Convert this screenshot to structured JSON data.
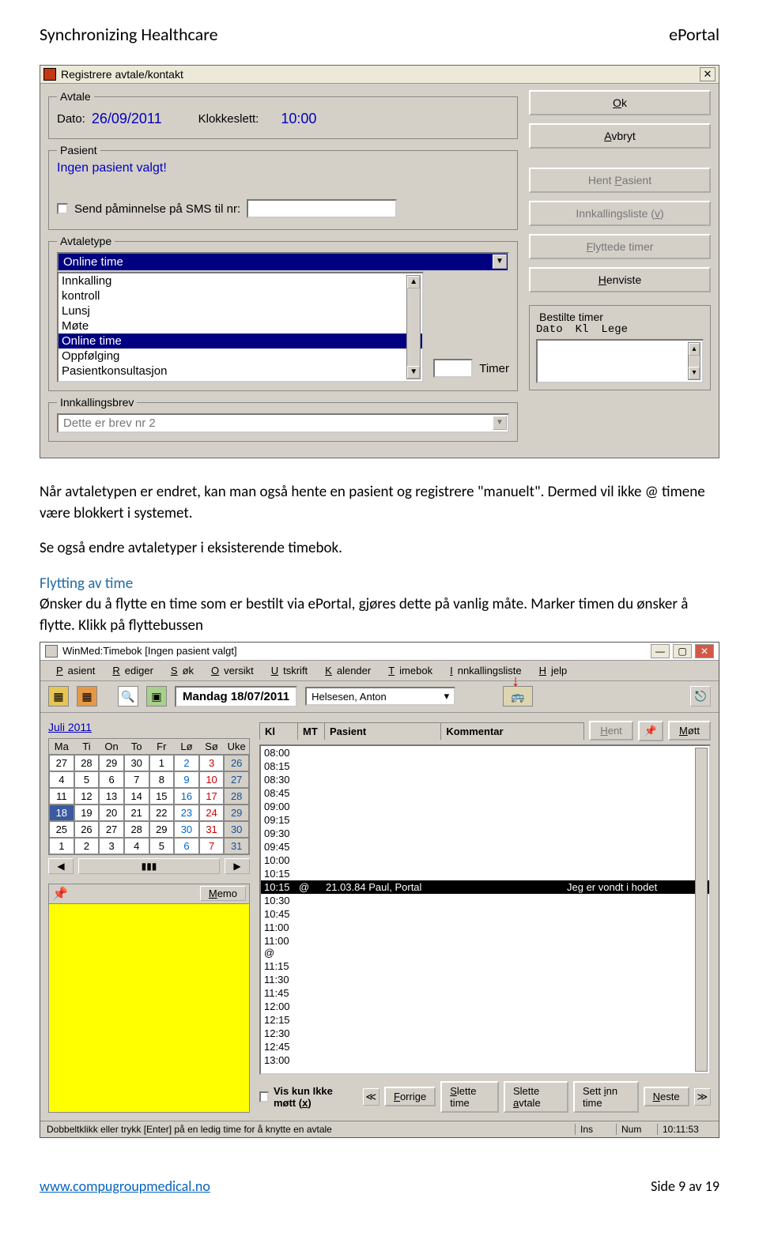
{
  "doc": {
    "header_left": "Synchronizing Healthcare",
    "header_right": "ePortal",
    "para1": "Når avtaletypen er endret, kan man også hente en pasient og registrere \"manuelt\". Dermed vil ikke @ timene være blokkert i systemet.",
    "para2": "Se også endre avtaletyper i eksisterende timebok.",
    "heading": "Flytting av time",
    "para3": "Ønsker du å flytte en time som er bestilt via ePortal, gjøres dette på vanlig måte. Marker timen du ønsker å flytte. Klikk på flyttebussen",
    "footer_url": "www.compugroupmedical.no",
    "footer_page": "Side 9 av 19"
  },
  "dlg1": {
    "title": "Registrere avtale/kontakt",
    "avtale_legend": "Avtale",
    "dato_label": "Dato:",
    "dato_value": "26/09/2011",
    "klokke_label": "Klokkeslett:",
    "klokke_value": "10:00",
    "pasient_legend": "Pasient",
    "pasient_empty": "Ingen pasient valgt!",
    "sms_label": "Send påminnelse på SMS til nr:",
    "avtaletype_legend": "Avtaletype",
    "avtaletype_selected": "Online time",
    "avtaletype_items": [
      "Innkalling",
      "kontroll",
      "Lunsj",
      "Møte",
      "Online time",
      "Oppfølging",
      "Pasientkonsultasjon"
    ],
    "timer_label": "Timer",
    "innkallingsbrev_legend": "Innkallingsbrev",
    "innkallingsbrev_value": "Dette er brev nr 2",
    "btn_ok": "Ok",
    "btn_avbryt": "Avbryt",
    "btn_hent_pasient": "Hent Pasient",
    "btn_innkallingsliste": "Innkallingsliste (v)",
    "btn_flyttede": "Flyttede timer",
    "btn_henviste": "Henviste",
    "bestilte_legend": "Bestilte timer",
    "bestilte_hdr": [
      "Dato",
      "Kl",
      "Lege"
    ]
  },
  "win2": {
    "title": "WinMed:Timebok [Ingen pasient valgt]",
    "menu": [
      "Pasient",
      "Rediger",
      "Søk",
      "Oversikt",
      "Utskrift",
      "Kalender",
      "Timebok",
      "Innkallingsliste",
      "Hjelp"
    ],
    "date_label": "Mandag 18/07/2011",
    "doctor": "Helsesen, Anton",
    "btn_hent": "Hent",
    "btn_mott": "Møtt",
    "month": "Juli 2011",
    "cal_days": [
      "Ma",
      "Ti",
      "On",
      "To",
      "Fr",
      "Lø",
      "Sø",
      "Uke"
    ],
    "cal_rows": [
      [
        "27",
        "28",
        "29",
        "30",
        "1",
        "2",
        "3",
        "26"
      ],
      [
        "4",
        "5",
        "6",
        "7",
        "8",
        "9",
        "10",
        "27"
      ],
      [
        "11",
        "12",
        "13",
        "14",
        "15",
        "16",
        "17",
        "28"
      ],
      [
        "18",
        "19",
        "20",
        "21",
        "22",
        "23",
        "24",
        "29"
      ],
      [
        "25",
        "26",
        "27",
        "28",
        "29",
        "30",
        "31",
        "30"
      ],
      [
        "1",
        "2",
        "3",
        "4",
        "5",
        "6",
        "7",
        "31"
      ]
    ],
    "memo_label": "Memo",
    "time_hdr": [
      "Kl",
      "MT",
      "Pasient",
      "Kommentar"
    ],
    "times1": [
      "08:00",
      "08:15",
      "08:30",
      "08:45",
      "09:00",
      "09:15",
      "09:30",
      "09:45",
      "10:00",
      "10:15"
    ],
    "sel_time": "10:15",
    "sel_mt": "@",
    "sel_mid": "21.03.84 Paul, Portal",
    "sel_comment": "Jeg er vondt i hodet",
    "times2": [
      "10:30",
      "10:45",
      "11:00",
      "11:00 @",
      "11:15",
      "11:30",
      "11:45",
      "12:00",
      "12:15",
      "12:30",
      "12:45",
      "13:00"
    ],
    "vis_kun": "Vis kun Ikke møtt (x)",
    "btn_forrige": "Forrige",
    "btn_slette_time": "Slette time",
    "btn_slette_avtale": "Slette avtale",
    "btn_sett_inn": "Sett inn time",
    "btn_neste": "Neste",
    "status_hint": "Dobbeltklikk eller trykk [Enter] på en ledig time for å knytte en avtale",
    "status_ins": "Ins",
    "status_num": "Num",
    "status_clock": "10:11:53"
  }
}
